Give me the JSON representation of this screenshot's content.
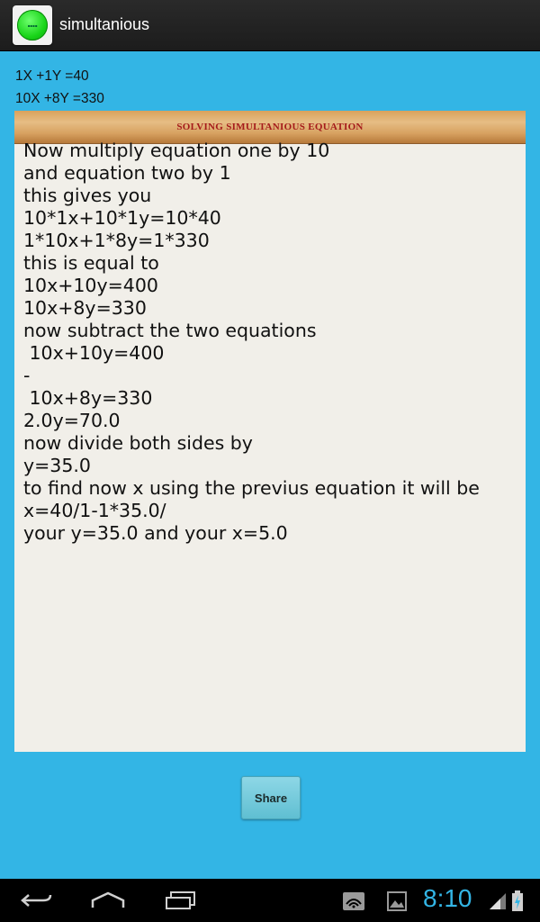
{
  "app": {
    "title": "simultanious",
    "icon": "app-green-dot-icon"
  },
  "equations": [
    "1X +1Y =40",
    "10X +8Y =330"
  ],
  "panel": {
    "banner": "SOLVING SIMULTANIOUS EQUATION",
    "lines": [
      "Now multiply equation one by 10",
      "and equation two by 1",
      "this gives you",
      "10*1x+10*1y=10*40",
      "1*10x+1*8y=1*330",
      "this is equal to",
      "10x+10y=400",
      "10x+8y=330",
      "now subtract the two equations",
      " 10x+10y=400",
      "-",
      " 10x+8y=330",
      "2.0y=70.0",
      "now divide both sides by",
      "y=35.0",
      "to find now x using the previus equation it will be",
      "x=40/1-1*35.0/",
      "your y=35.0 and your x=5.0"
    ]
  },
  "share_label": "Share",
  "status": {
    "time": "8:10"
  },
  "colors": {
    "background": "#33b5e5",
    "titlebar": "#1e1e1e",
    "clock": "#33b5e5"
  }
}
